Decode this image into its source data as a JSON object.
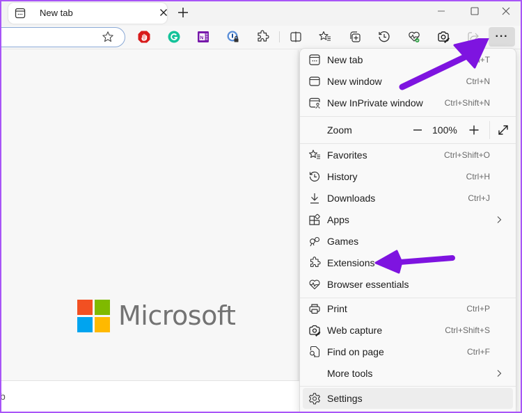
{
  "tab": {
    "title": "New tab"
  },
  "toolbar": {
    "more_label": "···",
    "extension_icons": [
      "adblock-icon",
      "grammarly-icon",
      "onenote-icon",
      "password-manager-icon"
    ],
    "buttons": [
      "extensions-icon",
      "split-screen-icon",
      "favorites-icon",
      "collections-icon",
      "history-icon",
      "browser-essentials-icon",
      "web-capture-icon",
      "share-icon"
    ]
  },
  "page": {
    "logo_text": "Microsoft",
    "logo_colors": [
      "#f25022",
      "#7fba00",
      "#00a4ef",
      "#ffb900"
    ],
    "bottom_text": "b"
  },
  "menu": {
    "items": [
      {
        "label": "New tab",
        "shortcut": "Ctrl+T",
        "icon": "new-tab-icon"
      },
      {
        "label": "New window",
        "shortcut": "Ctrl+N",
        "icon": "new-window-icon"
      },
      {
        "label": "New InPrivate window",
        "shortcut": "Ctrl+Shift+N",
        "icon": "inprivate-icon"
      },
      {
        "label": "Favorites",
        "shortcut": "Ctrl+Shift+O",
        "icon": "favorites-icon"
      },
      {
        "label": "History",
        "shortcut": "Ctrl+H",
        "icon": "history-icon"
      },
      {
        "label": "Downloads",
        "shortcut": "Ctrl+J",
        "icon": "downloads-icon"
      },
      {
        "label": "Apps",
        "shortcut": "",
        "icon": "apps-icon",
        "submenu": true
      },
      {
        "label": "Games",
        "shortcut": "",
        "icon": "games-icon"
      },
      {
        "label": "Extensions",
        "shortcut": "",
        "icon": "extensions-icon"
      },
      {
        "label": "Browser essentials",
        "shortcut": "",
        "icon": "browser-essentials-icon"
      },
      {
        "label": "Print",
        "shortcut": "Ctrl+P",
        "icon": "print-icon"
      },
      {
        "label": "Web capture",
        "shortcut": "Ctrl+Shift+S",
        "icon": "web-capture-icon"
      },
      {
        "label": "Find on page",
        "shortcut": "Ctrl+F",
        "icon": "find-icon"
      },
      {
        "label": "More tools",
        "shortcut": "",
        "icon": "",
        "submenu": true
      },
      {
        "label": "Settings",
        "shortcut": "",
        "icon": "settings-icon"
      }
    ],
    "zoom": {
      "label": "Zoom",
      "value": "100%"
    }
  },
  "annotations": {
    "arrow_color": "#7e14e0",
    "targets": [
      "more-button",
      "menu-item-extensions"
    ]
  }
}
